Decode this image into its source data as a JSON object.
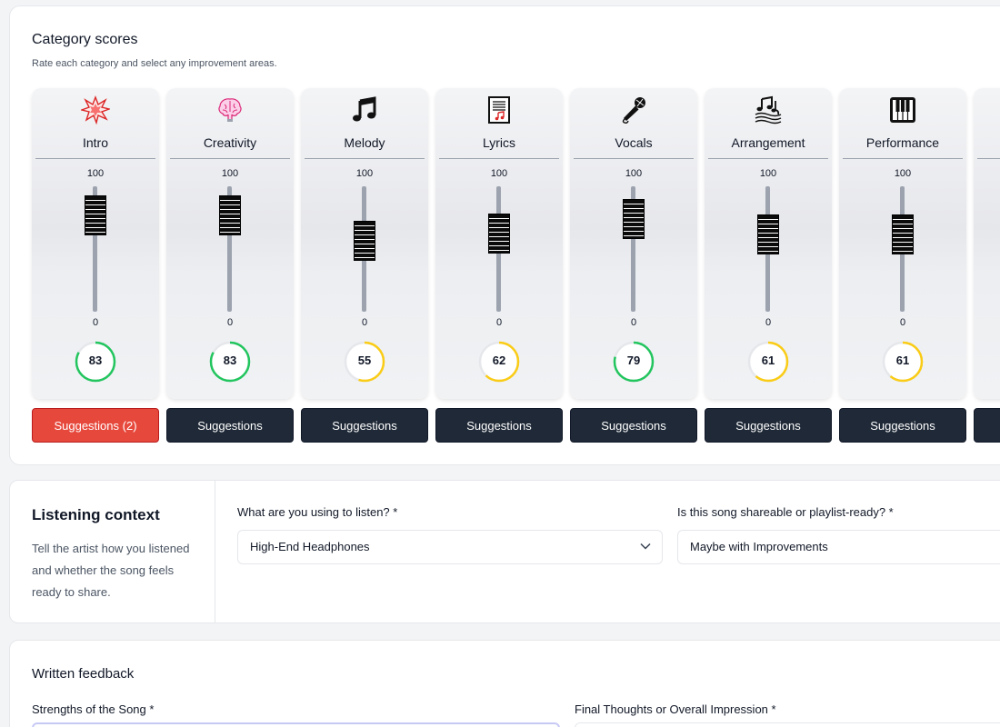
{
  "category_scores": {
    "title": "Category scores",
    "subtitle": "Rate each category and select any improvement areas.",
    "max_label": "100",
    "min_label": "0",
    "categories": [
      {
        "label": "Intro",
        "icon": "explosion-icon",
        "score": "83",
        "color": "#22c55e",
        "suggestions": "Suggestions (2)",
        "active": true
      },
      {
        "label": "Creativity",
        "icon": "brain-icon",
        "score": "83",
        "color": "#22c55e",
        "suggestions": "Suggestions",
        "active": false
      },
      {
        "label": "Melody",
        "icon": "music-note-icon",
        "score": "55",
        "color": "#facc15",
        "suggestions": "Suggestions",
        "active": false
      },
      {
        "label": "Lyrics",
        "icon": "sheet-music-icon",
        "score": "62",
        "color": "#facc15",
        "suggestions": "Suggestions",
        "active": false
      },
      {
        "label": "Vocals",
        "icon": "microphone-icon",
        "score": "79",
        "color": "#22c55e",
        "suggestions": "Suggestions",
        "active": false
      },
      {
        "label": "Arrangement",
        "icon": "notes-staff-icon",
        "score": "61",
        "color": "#facc15",
        "suggestions": "Suggestions",
        "active": false
      },
      {
        "label": "Performance",
        "icon": "piano-keys-icon",
        "score": "61",
        "color": "#facc15",
        "suggestions": "Suggestions",
        "active": false
      }
    ]
  },
  "listening_context": {
    "title": "Listening context",
    "description": "Tell the artist how you listened and whether the song feels ready to share.",
    "device_label": "What are you using to listen? *",
    "device_value": "High-End Headphones",
    "shareable_label": "Is this song shareable or playlist-ready? *",
    "shareable_value": "Maybe with Improvements"
  },
  "written_feedback": {
    "title": "Written feedback",
    "strengths_label": "Strengths of the Song *",
    "final_label": "Final Thoughts or Overall Impression *"
  }
}
